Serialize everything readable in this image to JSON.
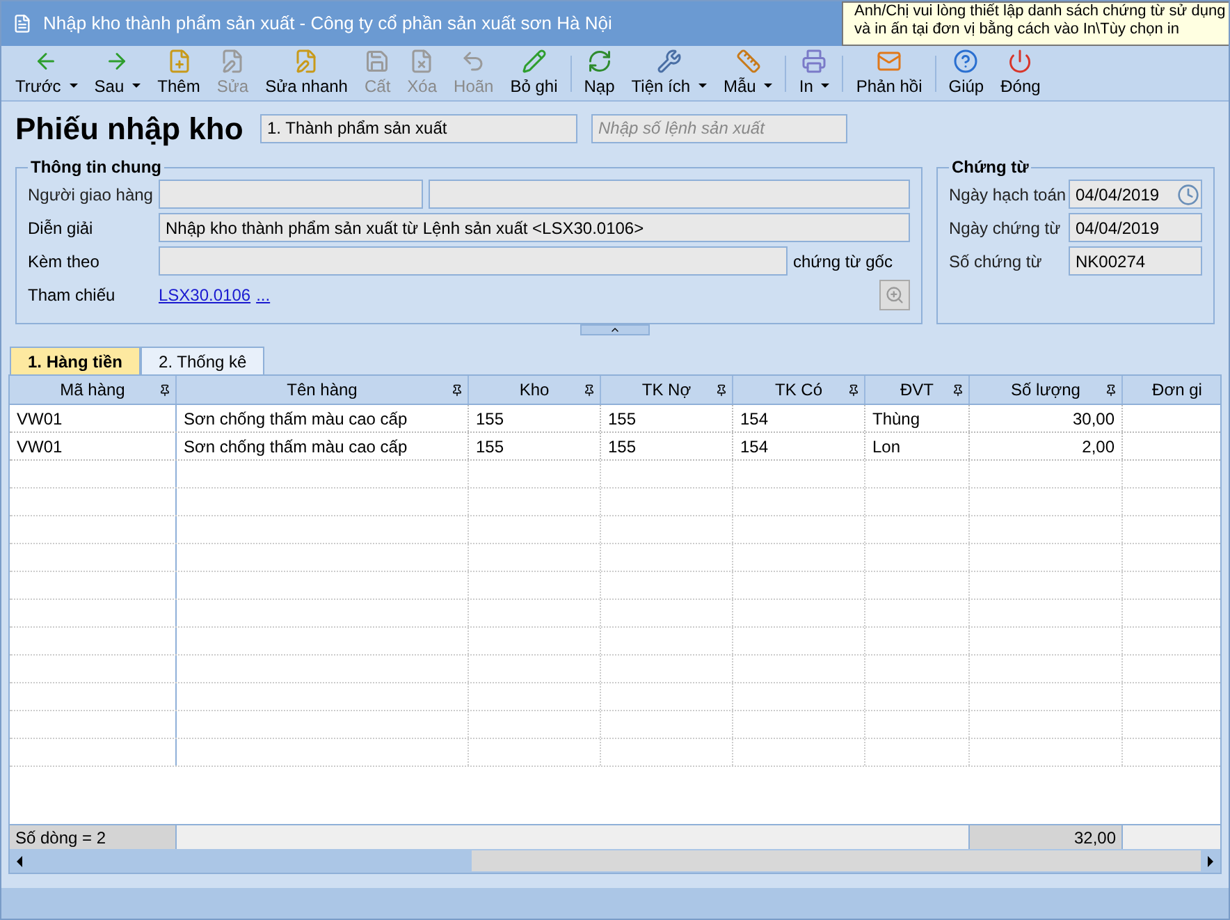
{
  "window": {
    "title": "Nhập kho thành phẩm sản xuất - Công ty cổ phần sản xuất sơn Hà Nội"
  },
  "tooltip": {
    "lines": [
      "Anh/Chị vui lòng thiết lập danh sách chứng từ sử dụng",
      "và in ấn tại đơn vị bằng cách vào In\\Tùy chọn in"
    ]
  },
  "toolbar": [
    {
      "label": "Trước",
      "disabled": false,
      "dropdown": true
    },
    {
      "label": "Sau",
      "disabled": false,
      "dropdown": true
    },
    {
      "label": "Thêm",
      "disabled": false,
      "dropdown": false
    },
    {
      "label": "Sửa",
      "disabled": true,
      "dropdown": false
    },
    {
      "label": "Sửa nhanh",
      "disabled": false,
      "dropdown": false
    },
    {
      "label": "Cất",
      "disabled": true,
      "dropdown": false
    },
    {
      "label": "Xóa",
      "disabled": true,
      "dropdown": false
    },
    {
      "label": "Hoãn",
      "disabled": true,
      "dropdown": false
    },
    {
      "label": "Bỏ ghi",
      "disabled": false,
      "dropdown": false
    },
    {
      "label": "Nạp",
      "disabled": false,
      "dropdown": false
    },
    {
      "label": "Tiện ích",
      "disabled": false,
      "dropdown": true
    },
    {
      "label": "Mẫu",
      "disabled": false,
      "dropdown": true
    },
    {
      "label": "In",
      "disabled": false,
      "dropdown": true
    },
    {
      "label": "Phản hồi",
      "disabled": false,
      "dropdown": false
    },
    {
      "label": "Giúp",
      "disabled": false,
      "dropdown": false
    },
    {
      "label": "Đóng",
      "disabled": false,
      "dropdown": false
    }
  ],
  "header": {
    "title": "Phiếu nhập kho",
    "type_value": "1. Thành phẩm sản xuất",
    "order_placeholder": "Nhập số lệnh sản xuất"
  },
  "general": {
    "title": "Thông tin chung",
    "deliverer_label": "Người giao hàng",
    "description_label": "Diễn giải",
    "description_value": "Nhập kho thành phẩm sản xuất từ Lệnh sản xuất <LSX30.0106>",
    "attach_label": "Kèm theo",
    "attach_suffix": "chứng từ gốc",
    "reference_label": "Tham chiếu",
    "reference_link": "LSX30.0106",
    "reference_more": "..."
  },
  "voucher": {
    "title": "Chứng từ",
    "fields": [
      {
        "label": "Ngày hạch toán",
        "value": "04/04/2019",
        "kind": "date"
      },
      {
        "label": "Ngày chứng từ",
        "value": "04/04/2019",
        "kind": "text"
      },
      {
        "label": "Số chứng từ",
        "value": "NK00274",
        "kind": "text"
      }
    ]
  },
  "tabs": [
    {
      "label": "1. Hàng tiền",
      "selected": true
    },
    {
      "label": "2. Thống kê",
      "selected": false
    }
  ],
  "table": {
    "columns": [
      "Mã hàng",
      "Tên hàng",
      "Kho",
      "TK Nợ",
      "TK Có",
      "ĐVT",
      "Số lượng",
      "Đơn gi"
    ],
    "rows": [
      [
        "VW01",
        "Sơn chống thấm màu cao cấp",
        "155",
        "155",
        "154",
        "Thùng",
        "30,00",
        ""
      ],
      [
        "VW01",
        "Sơn chống thấm màu cao cấp",
        "155",
        "155",
        "154",
        "Lon",
        "2,00",
        ""
      ]
    ],
    "footer": {
      "count": "Số dòng = 2",
      "quantity_total": "32,00"
    }
  }
}
